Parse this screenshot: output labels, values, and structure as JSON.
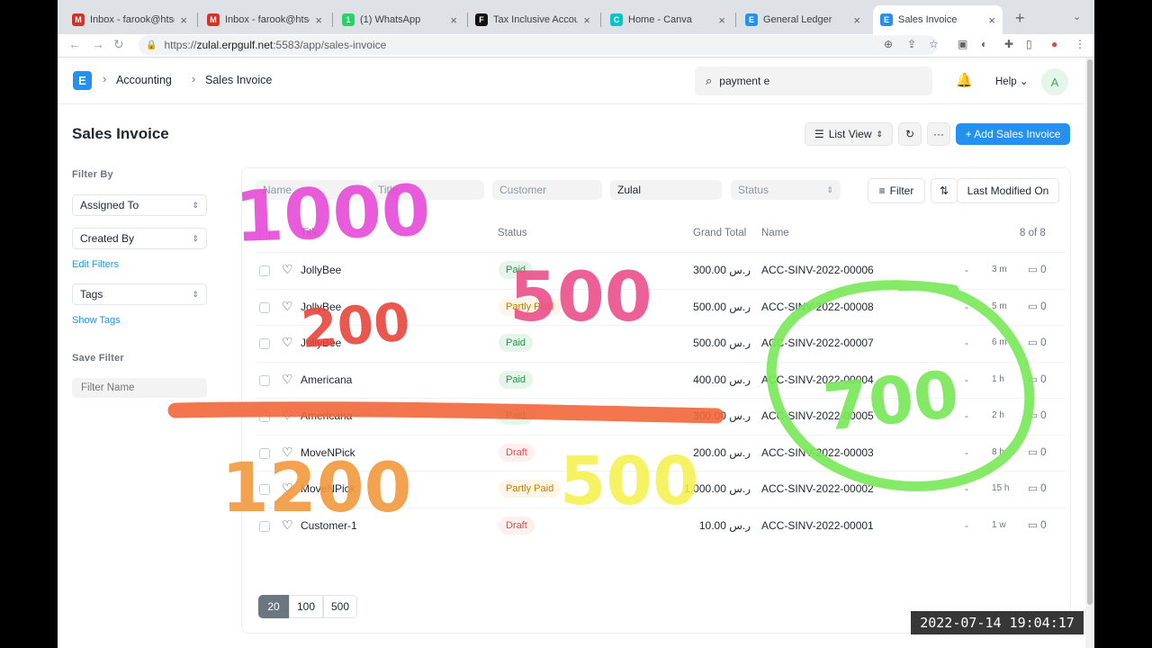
{
  "browser": {
    "tabs": [
      {
        "label": "Inbox - farook@htsqa",
        "icon": "gmail-icon",
        "color": "#d93025",
        "glyph": "M"
      },
      {
        "label": "Inbox - farook@htsqa",
        "icon": "gmail-icon",
        "color": "#d93025",
        "glyph": "M"
      },
      {
        "label": "(1) WhatsApp",
        "icon": "whatsapp-icon",
        "color": "#25d366",
        "glyph": "1"
      },
      {
        "label": "Tax Inclusive Account",
        "icon": "frappe-icon",
        "color": "#111111",
        "glyph": "F"
      },
      {
        "label": "Home - Canva",
        "icon": "canva-icon",
        "color": "#00c4cc",
        "glyph": "C"
      },
      {
        "label": "General Ledger",
        "icon": "erpnext-icon",
        "color": "#2490ef",
        "glyph": "E"
      },
      {
        "label": "Sales Invoice",
        "icon": "erpnext-icon",
        "color": "#2490ef",
        "glyph": "E"
      }
    ],
    "url_prefix": "https://",
    "url_host": "zulal.erpgulf.net",
    "url_rest": ":5583/app/sales-invoice"
  },
  "nav": {
    "breadcrumb_1": "Accounting",
    "breadcrumb_2": "Sales Invoice",
    "search_value": "payment e",
    "help_label": "Help",
    "avatar_initial": "A"
  },
  "page": {
    "title": "Sales Invoice",
    "list_view_label": "List View",
    "add_button_label": "+ Add Sales Invoice"
  },
  "sidebar": {
    "filter_by": "Filter By",
    "assigned_to": "Assigned To",
    "created_by": "Created By",
    "edit_filters": "Edit Filters",
    "tags": "Tags",
    "show_tags": "Show Tags",
    "save_filter": "Save Filter",
    "filter_name_placeholder": "Filter Name"
  },
  "filters": {
    "name_placeholder": "Name",
    "title_placeholder": "Title",
    "customer_placeholder": "Customer",
    "company_value": "Zulal",
    "status_placeholder": "Status",
    "filter_button": "Filter",
    "sort_label": "Last Modified On"
  },
  "table": {
    "headers": {
      "title": "Title",
      "status": "Status",
      "grand_total": "Grand Total",
      "name": "Name",
      "count": "8 of 8"
    },
    "rows": [
      {
        "title": "JollyBee",
        "status": "Paid",
        "status_type": "paid",
        "total": "300.00 ر.س",
        "name": "ACC-SINV-2022-00006",
        "time": "3 m",
        "comments": "0"
      },
      {
        "title": "JollyBee",
        "status": "Partly Paid",
        "status_type": "partly",
        "total": "500.00 ر.س",
        "name": "ACC-SINV-2022-00008",
        "time": "5 m",
        "comments": "0"
      },
      {
        "title": "JollyBee",
        "status": "Paid",
        "status_type": "paid",
        "total": "500.00 ر.س",
        "name": "ACC-SINV-2022-00007",
        "time": "6 m",
        "comments": "0"
      },
      {
        "title": "Americana",
        "status": "Paid",
        "status_type": "paid",
        "total": "400.00 ر.س",
        "name": "ACC-SINV-2022-00004",
        "time": "1 h",
        "comments": "0"
      },
      {
        "title": "Americana",
        "status": "Paid",
        "status_type": "paid",
        "total": "300.00 ر.س",
        "name": "ACC-SINV-2022-00005",
        "time": "2 h",
        "comments": "0"
      },
      {
        "title": "MoveNPick",
        "status": "Draft",
        "status_type": "draft",
        "total": "200.00 ر.س",
        "name": "ACC-SINV-2022-00003",
        "time": "8 h",
        "comments": "0"
      },
      {
        "title": "MoveNPick",
        "status": "Partly Paid",
        "status_type": "partly",
        "total": "1,000.00 ر.س",
        "name": "ACC-SINV-2022-00002",
        "time": "15 h",
        "comments": "0"
      },
      {
        "title": "Customer-1",
        "status": "Draft",
        "status_type": "draft",
        "total": "10.00 ر.س",
        "name": "ACC-SINV-2022-00001",
        "time": "1 w",
        "comments": "0"
      }
    ]
  },
  "paging": [
    "20",
    "100",
    "500"
  ],
  "video_timestamp": "2022-07-14 19:04:17",
  "annotations": [
    {
      "text": "1000",
      "color": "#e64ad6"
    },
    {
      "text": "500",
      "color": "#ec4f8a"
    },
    {
      "text": "200",
      "color": "#e8453c"
    },
    {
      "text": "700",
      "color": "#79e85a"
    },
    {
      "text": "1200",
      "color": "#f29a3c"
    },
    {
      "text": "500",
      "color": "#f4f04a"
    }
  ]
}
